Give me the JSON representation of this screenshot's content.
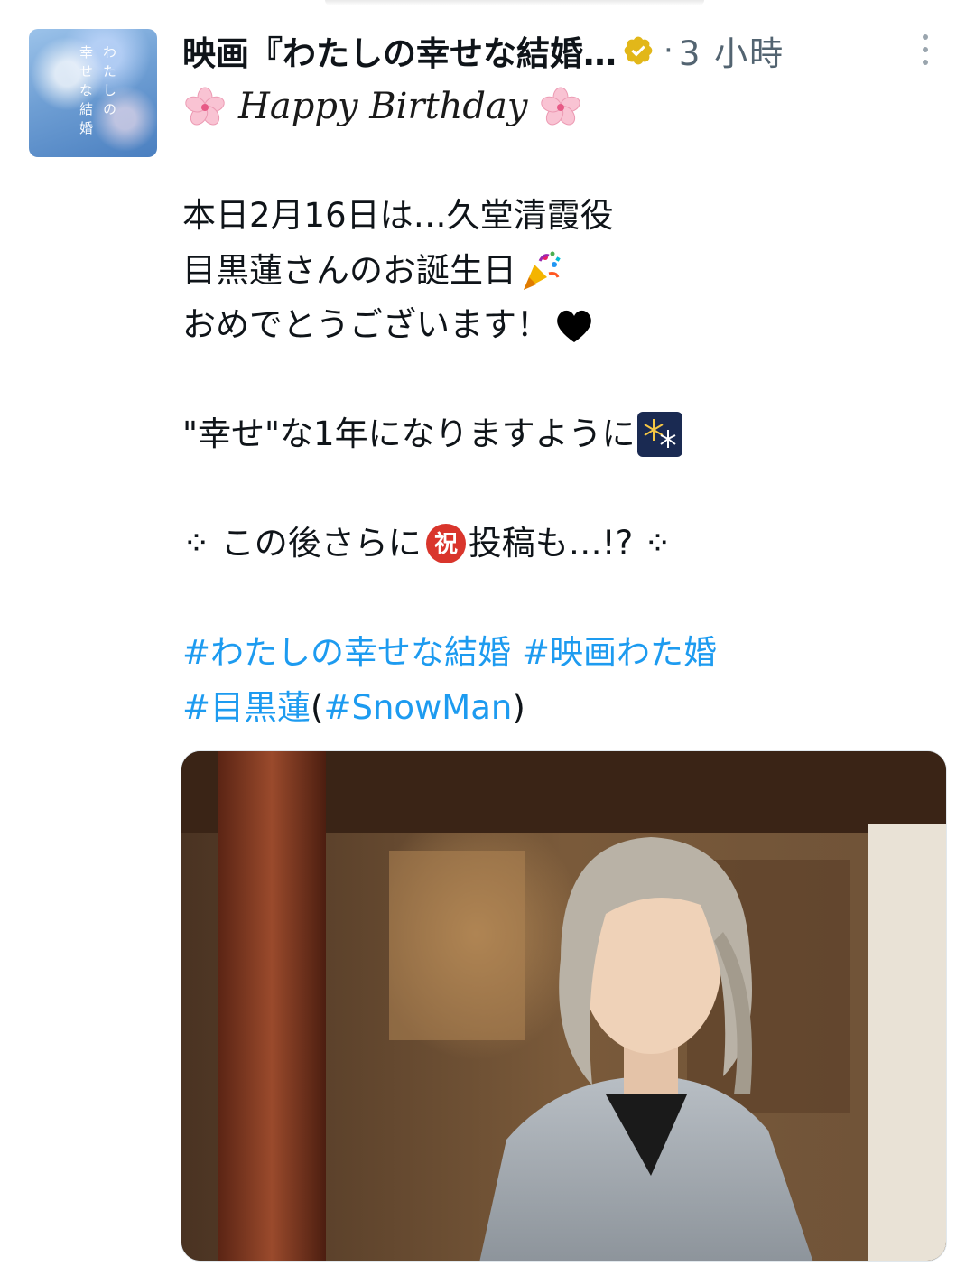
{
  "tweet": {
    "author_name": "映画『わたしの幸せな結婚…",
    "separator": "·",
    "timestamp": "3 小時",
    "avatar_text": {
      "line1": "わたしの",
      "line2": "幸せな結婚"
    },
    "lines": [
      "Happy Birthday",
      "本日2月16日は…久堂清霞役",
      "目黒蓮さんのお誕生日",
      "おめでとうございます！",
      "\"幸せ\"な1年になりますように",
      "⁘ この後さらに",
      "投稿も…!? ⁘"
    ],
    "hashtags": {
      "tag1": "#わたしの幸せな結婚",
      "tag2": "#映画わた婚",
      "tag3": "#目黒蓮",
      "paren_open": "(",
      "tag4": "#SnowMan",
      "paren_close": ")"
    },
    "icons": {
      "verified": "verified-gold-icon",
      "more": "more-options-icon",
      "blossom": "cherry-blossom-emoji",
      "party": "party-popper-emoji",
      "heart": "black-heart-emoji",
      "fireworks": "fireworks-emoji",
      "celebrate": "congratulations-ideograph-emoji"
    }
  },
  "colors": {
    "link": "#1d9bf0",
    "text": "#0f1419",
    "muted": "#536471",
    "verified_gold": "#e2b719"
  }
}
